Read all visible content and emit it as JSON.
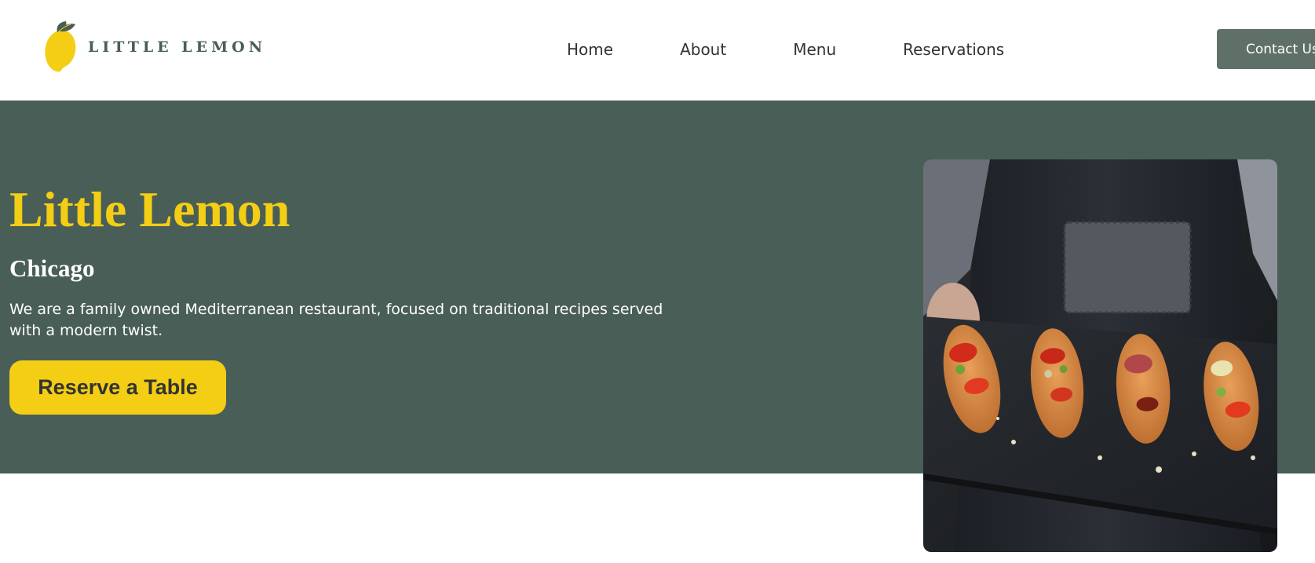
{
  "brand": {
    "name": "LITTLE LEMON",
    "logo_icon": "lemon-icon",
    "colors": {
      "primary_green": "#495e57",
      "primary_yellow": "#f4ce14",
      "button_grey_green": "#5f7068"
    }
  },
  "nav": {
    "items": [
      {
        "label": "Home"
      },
      {
        "label": "About"
      },
      {
        "label": "Menu"
      },
      {
        "label": "Reservations"
      }
    ],
    "contact_label": "Contact Us"
  },
  "hero": {
    "title": "Little Lemon",
    "city": "Chicago",
    "description": "We are a family owned Mediterranean restaurant, focused on traditional recipes served with a modern twist.",
    "cta_label": "Reserve a Table",
    "image_subject": "food-photo"
  }
}
